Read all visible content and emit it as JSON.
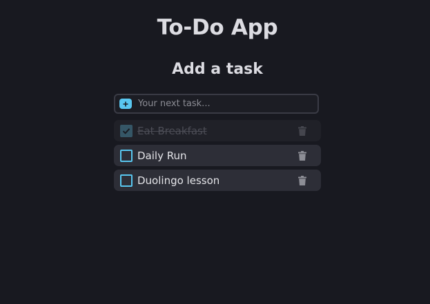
{
  "app": {
    "title": "To-Do App"
  },
  "form": {
    "heading": "Add a task",
    "placeholder": "Your next task...",
    "value": ""
  },
  "tasks": [
    {
      "label": "Eat Breakfast",
      "completed": true
    },
    {
      "label": "Daily Run",
      "completed": false
    },
    {
      "label": "Duolingo lesson",
      "completed": false
    }
  ],
  "colors": {
    "background": "#181920",
    "task_background": "#2d2e37",
    "completed_task_background": "#202128",
    "accent": "#59c7f0",
    "text": "#e4e4e8",
    "muted_text": "#4c4d56"
  },
  "icons": {
    "add": "plus-icon",
    "checkbox_checked": "check-icon",
    "delete": "trash-icon"
  }
}
